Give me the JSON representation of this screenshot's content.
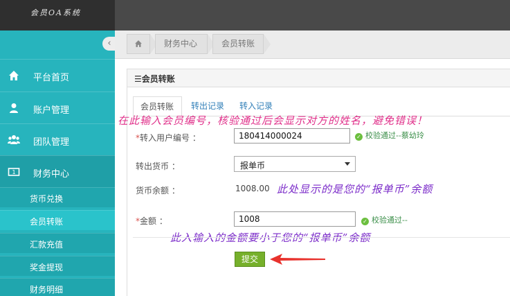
{
  "app": {
    "title": "会员OA系统"
  },
  "sidebar": {
    "collapse_icon": "‹",
    "items": [
      {
        "label": "平台首页",
        "icon": "home-icon"
      },
      {
        "label": "账户管理",
        "icon": "user-icon"
      },
      {
        "label": "团队管理",
        "icon": "users-icon"
      },
      {
        "label": "财务中心",
        "icon": "finance-icon"
      }
    ],
    "sub_items": [
      {
        "label": "货币兑换"
      },
      {
        "label": "会员转账"
      },
      {
        "label": "汇款充值"
      },
      {
        "label": "奖金提现"
      },
      {
        "label": "财务明细"
      }
    ]
  },
  "breadcrumb": {
    "home_icon": "home-icon",
    "items": [
      "财务中心",
      "会员转账"
    ]
  },
  "panel": {
    "title": "会员转账"
  },
  "tabs": [
    "会员转账",
    "转出记录",
    "转入记录"
  ],
  "form": {
    "recipient_label": "转入用户编号 ：",
    "recipient_value": "180414000024",
    "recipient_status": "校验通过--蔡幼玲",
    "currency_label": "转出货币 ：",
    "currency_value": "报单币",
    "balance_label": "货币余额 ：",
    "balance_value": "1008.00",
    "amount_label": "金额 ：",
    "amount_value": "1008",
    "amount_status": "校验通过--",
    "submit_label": "提交"
  },
  "annotations": {
    "top": "在此输入会员编号，核验通过后会显示对方的姓名，避免错误！",
    "balance": "此处显示的是您的“报单币”余额",
    "amount": "此入输入的金额要小于您的“报单币”余额"
  },
  "colors": {
    "sidebar": "#27b4bd",
    "topbar": "#494949",
    "submit": "#76b02b",
    "note_purple": "#7b2bc9",
    "note_pink": "#e0308a"
  }
}
